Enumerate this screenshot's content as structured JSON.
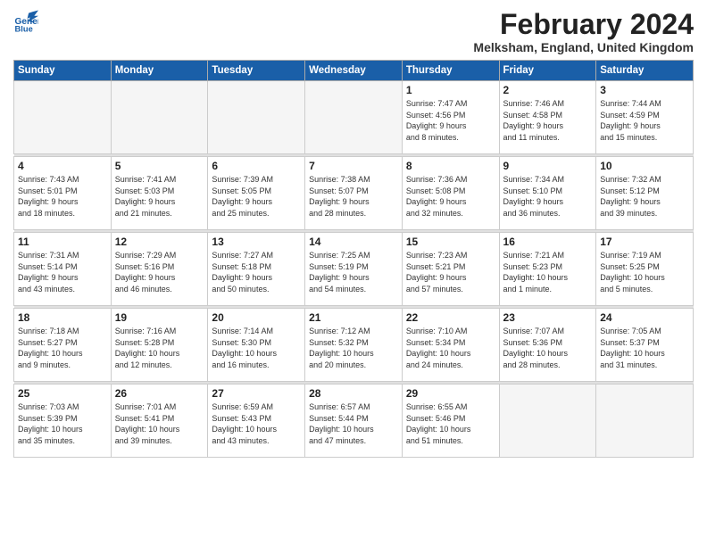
{
  "header": {
    "logo_line1": "General",
    "logo_line2": "Blue",
    "month_title": "February 2024",
    "location": "Melksham, England, United Kingdom"
  },
  "weekdays": [
    "Sunday",
    "Monday",
    "Tuesday",
    "Wednesday",
    "Thursday",
    "Friday",
    "Saturday"
  ],
  "weeks": [
    [
      {
        "day": "",
        "info": ""
      },
      {
        "day": "",
        "info": ""
      },
      {
        "day": "",
        "info": ""
      },
      {
        "day": "",
        "info": ""
      },
      {
        "day": "1",
        "info": "Sunrise: 7:47 AM\nSunset: 4:56 PM\nDaylight: 9 hours\nand 8 minutes."
      },
      {
        "day": "2",
        "info": "Sunrise: 7:46 AM\nSunset: 4:58 PM\nDaylight: 9 hours\nand 11 minutes."
      },
      {
        "day": "3",
        "info": "Sunrise: 7:44 AM\nSunset: 4:59 PM\nDaylight: 9 hours\nand 15 minutes."
      }
    ],
    [
      {
        "day": "4",
        "info": "Sunrise: 7:43 AM\nSunset: 5:01 PM\nDaylight: 9 hours\nand 18 minutes."
      },
      {
        "day": "5",
        "info": "Sunrise: 7:41 AM\nSunset: 5:03 PM\nDaylight: 9 hours\nand 21 minutes."
      },
      {
        "day": "6",
        "info": "Sunrise: 7:39 AM\nSunset: 5:05 PM\nDaylight: 9 hours\nand 25 minutes."
      },
      {
        "day": "7",
        "info": "Sunrise: 7:38 AM\nSunset: 5:07 PM\nDaylight: 9 hours\nand 28 minutes."
      },
      {
        "day": "8",
        "info": "Sunrise: 7:36 AM\nSunset: 5:08 PM\nDaylight: 9 hours\nand 32 minutes."
      },
      {
        "day": "9",
        "info": "Sunrise: 7:34 AM\nSunset: 5:10 PM\nDaylight: 9 hours\nand 36 minutes."
      },
      {
        "day": "10",
        "info": "Sunrise: 7:32 AM\nSunset: 5:12 PM\nDaylight: 9 hours\nand 39 minutes."
      }
    ],
    [
      {
        "day": "11",
        "info": "Sunrise: 7:31 AM\nSunset: 5:14 PM\nDaylight: 9 hours\nand 43 minutes."
      },
      {
        "day": "12",
        "info": "Sunrise: 7:29 AM\nSunset: 5:16 PM\nDaylight: 9 hours\nand 46 minutes."
      },
      {
        "day": "13",
        "info": "Sunrise: 7:27 AM\nSunset: 5:18 PM\nDaylight: 9 hours\nand 50 minutes."
      },
      {
        "day": "14",
        "info": "Sunrise: 7:25 AM\nSunset: 5:19 PM\nDaylight: 9 hours\nand 54 minutes."
      },
      {
        "day": "15",
        "info": "Sunrise: 7:23 AM\nSunset: 5:21 PM\nDaylight: 9 hours\nand 57 minutes."
      },
      {
        "day": "16",
        "info": "Sunrise: 7:21 AM\nSunset: 5:23 PM\nDaylight: 10 hours\nand 1 minute."
      },
      {
        "day": "17",
        "info": "Sunrise: 7:19 AM\nSunset: 5:25 PM\nDaylight: 10 hours\nand 5 minutes."
      }
    ],
    [
      {
        "day": "18",
        "info": "Sunrise: 7:18 AM\nSunset: 5:27 PM\nDaylight: 10 hours\nand 9 minutes."
      },
      {
        "day": "19",
        "info": "Sunrise: 7:16 AM\nSunset: 5:28 PM\nDaylight: 10 hours\nand 12 minutes."
      },
      {
        "day": "20",
        "info": "Sunrise: 7:14 AM\nSunset: 5:30 PM\nDaylight: 10 hours\nand 16 minutes."
      },
      {
        "day": "21",
        "info": "Sunrise: 7:12 AM\nSunset: 5:32 PM\nDaylight: 10 hours\nand 20 minutes."
      },
      {
        "day": "22",
        "info": "Sunrise: 7:10 AM\nSunset: 5:34 PM\nDaylight: 10 hours\nand 24 minutes."
      },
      {
        "day": "23",
        "info": "Sunrise: 7:07 AM\nSunset: 5:36 PM\nDaylight: 10 hours\nand 28 minutes."
      },
      {
        "day": "24",
        "info": "Sunrise: 7:05 AM\nSunset: 5:37 PM\nDaylight: 10 hours\nand 31 minutes."
      }
    ],
    [
      {
        "day": "25",
        "info": "Sunrise: 7:03 AM\nSunset: 5:39 PM\nDaylight: 10 hours\nand 35 minutes."
      },
      {
        "day": "26",
        "info": "Sunrise: 7:01 AM\nSunset: 5:41 PM\nDaylight: 10 hours\nand 39 minutes."
      },
      {
        "day": "27",
        "info": "Sunrise: 6:59 AM\nSunset: 5:43 PM\nDaylight: 10 hours\nand 43 minutes."
      },
      {
        "day": "28",
        "info": "Sunrise: 6:57 AM\nSunset: 5:44 PM\nDaylight: 10 hours\nand 47 minutes."
      },
      {
        "day": "29",
        "info": "Sunrise: 6:55 AM\nSunset: 5:46 PM\nDaylight: 10 hours\nand 51 minutes."
      },
      {
        "day": "",
        "info": ""
      },
      {
        "day": "",
        "info": ""
      }
    ]
  ]
}
